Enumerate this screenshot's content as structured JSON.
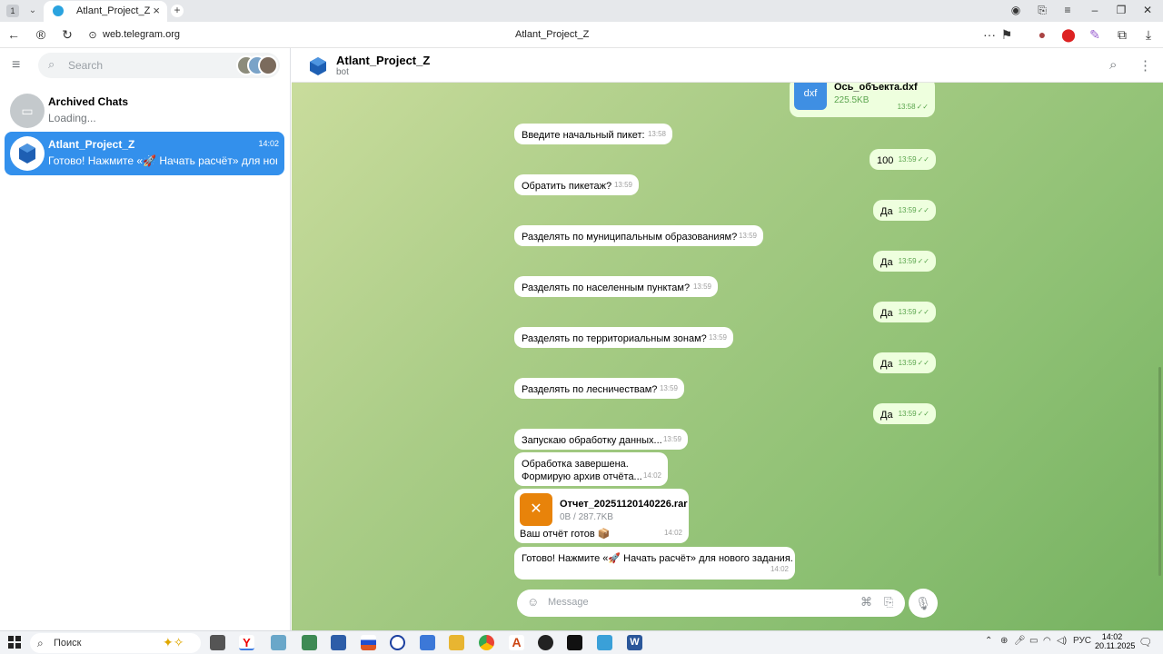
{
  "browser": {
    "tab_count": "1",
    "tab_title": "Atlant_Project_Z",
    "url": "web.telegram.org",
    "page_title": "Atlant_Project_Z"
  },
  "sidebar": {
    "search_placeholder": "Search",
    "archived": {
      "name": "Archived Chats",
      "sub": "Loading..."
    },
    "chats": [
      {
        "name": "Atlant_Project_Z",
        "time": "14:02",
        "preview": "Готово! Нажмите «🚀 Начать расчёт» для нового..."
      }
    ]
  },
  "chat": {
    "name": "Atlant_Project_Z",
    "status": "bot",
    "messages": [
      {
        "dir": "out",
        "file_name": "Ось_объекта.dxf",
        "file_size": "225.5KB",
        "file_ext": "dxf",
        "time": "13:58"
      },
      {
        "dir": "in",
        "text": "Введите начальный пикет:",
        "time": "13:58"
      },
      {
        "dir": "out",
        "text": "100",
        "time": "13:59"
      },
      {
        "dir": "in",
        "text": "Обратить пикетаж?",
        "time": "13:59"
      },
      {
        "dir": "out",
        "text": "Да",
        "time": "13:59"
      },
      {
        "dir": "in",
        "text": "Разделять по муниципальным образованиям?",
        "time": "13:59"
      },
      {
        "dir": "out",
        "text": "Да",
        "time": "13:59"
      },
      {
        "dir": "in",
        "text": "Разделять по населенным пунктам?",
        "time": "13:59"
      },
      {
        "dir": "out",
        "text": "Да",
        "time": "13:59"
      },
      {
        "dir": "in",
        "text": "Разделять по территориальным зонам?",
        "time": "13:59"
      },
      {
        "dir": "out",
        "text": "Да",
        "time": "13:59"
      },
      {
        "dir": "in",
        "text": "Разделять по лесничествам?",
        "time": "13:59"
      },
      {
        "dir": "out",
        "text": "Да",
        "time": "13:59"
      },
      {
        "dir": "in",
        "text": "Запускаю обработку данных...",
        "time": "13:59"
      },
      {
        "dir": "in",
        "line1": "Обработка завершена.",
        "line2": "Формирую архив отчёта...",
        "time": "14:02"
      },
      {
        "dir": "in",
        "file_name": "Отчет_20251120140226.rar",
        "file_size": "0B / 287.7KB",
        "caption": "Ваш отчёт готов 📦",
        "time": "14:02"
      },
      {
        "dir": "in",
        "text": "Готово! Нажмите «🚀 Начать расчёт» для нового задания.",
        "time": "14:02"
      }
    ],
    "composer_placeholder": "Message"
  },
  "taskbar": {
    "search_label": "Поиск",
    "lang": "РУС",
    "time": "14:02",
    "date": "20.11.2025"
  },
  "colors": {
    "accent": "#3390ec",
    "outgoing_bubble": "#eeffde",
    "chat_bg": "#9cc77d"
  }
}
